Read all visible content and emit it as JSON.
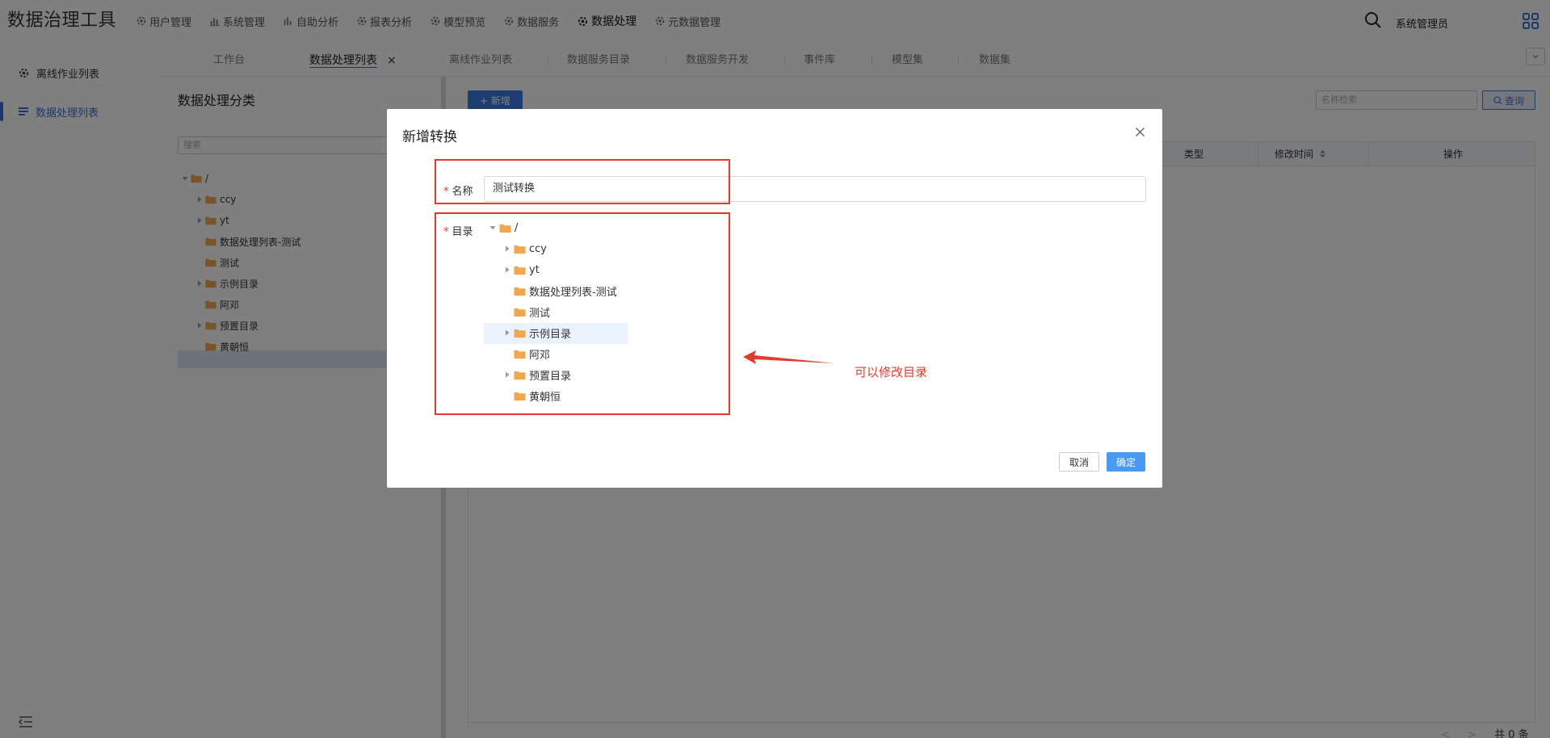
{
  "app": {
    "title": "数据治理工具"
  },
  "nav": {
    "items": [
      {
        "label": "用户管理",
        "icon": "gear-icon"
      },
      {
        "label": "系统管理",
        "icon": "bar-chart-icon"
      },
      {
        "label": "自助分析",
        "icon": "bar-chart-icon"
      },
      {
        "label": "报表分析",
        "icon": "gear-icon"
      },
      {
        "label": "模型预览",
        "icon": "gear-icon"
      },
      {
        "label": "数据服务",
        "icon": "gear-icon"
      },
      {
        "label": "数据处理",
        "icon": "gear-icon"
      },
      {
        "label": "元数据管理",
        "icon": "gear-icon"
      }
    ],
    "active_index": 6
  },
  "user": {
    "name": "系统管理员"
  },
  "tabs": {
    "items": [
      {
        "label": "工作台"
      },
      {
        "label": "数据处理列表",
        "close": "×"
      },
      {
        "label": "离线作业列表"
      },
      {
        "label": "数据服务目录"
      },
      {
        "label": "数据服务开发"
      },
      {
        "label": "事件库"
      },
      {
        "label": "模型集"
      },
      {
        "label": "数据集"
      }
    ],
    "active_index": 1
  },
  "sidebar": {
    "items": [
      {
        "label": "离线作业列表",
        "icon": "gear-icon"
      },
      {
        "label": "数据处理列表",
        "icon": "list-icon"
      }
    ],
    "active_index": 1
  },
  "category": {
    "title": "数据处理分类",
    "search_placeholder": "搜索",
    "tree": [
      {
        "label": "/",
        "expanded": true,
        "has_children": true,
        "level": 0
      },
      {
        "label": "ccy",
        "has_children": true,
        "level": 1
      },
      {
        "label": "yt",
        "has_children": true,
        "level": 1
      },
      {
        "label": "数据处理列表-测试",
        "has_children": false,
        "level": 1
      },
      {
        "label": "测试",
        "has_children": false,
        "level": 1
      },
      {
        "label": "示例目录",
        "has_children": true,
        "level": 1,
        "selected": true
      },
      {
        "label": "阿邓",
        "has_children": false,
        "level": 1
      },
      {
        "label": "预置目录",
        "has_children": true,
        "level": 1
      },
      {
        "label": "黄朝恒",
        "has_children": false,
        "level": 1
      }
    ]
  },
  "main": {
    "new_button": "+ 新增",
    "search_placeholder": "名称检索",
    "query_button": "查询",
    "columns": [
      {
        "label": "类型"
      },
      {
        "label": "修改时间"
      },
      {
        "label": "操作"
      }
    ],
    "total_text": "共 0 条"
  },
  "dialog": {
    "title": "新增转换",
    "name_label": "名称",
    "name_value": "测试转换",
    "dir_label": "目录",
    "required_mark": "*",
    "tree": [
      {
        "label": "/",
        "expanded": true,
        "has_children": true,
        "level": 0
      },
      {
        "label": "ccy",
        "has_children": true,
        "level": 1
      },
      {
        "label": "yt",
        "has_children": true,
        "level": 1
      },
      {
        "label": "数据处理列表-测试",
        "has_children": false,
        "level": 1
      },
      {
        "label": "测试",
        "has_children": false,
        "level": 1
      },
      {
        "label": "示例目录",
        "has_children": true,
        "level": 1,
        "selected": true
      },
      {
        "label": "阿邓",
        "has_children": false,
        "level": 1
      },
      {
        "label": "预置目录",
        "has_children": true,
        "level": 1
      },
      {
        "label": "黄朝恒",
        "has_children": false,
        "level": 1
      }
    ],
    "cancel": "取消",
    "ok": "确定"
  },
  "annotation": {
    "text": "可以修改目录",
    "color": "#e23b2e"
  },
  "colors": {
    "accent": "#3a7be0",
    "folder": "#f0a850",
    "annotation": "#e23b2e"
  }
}
